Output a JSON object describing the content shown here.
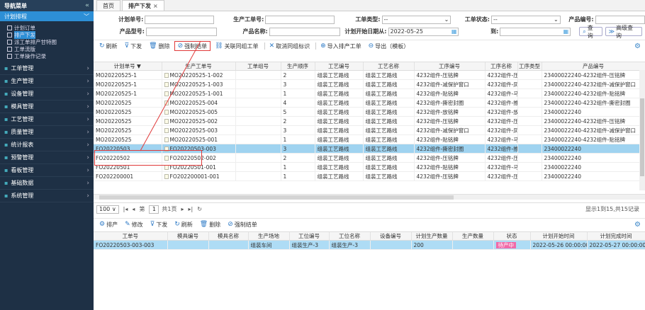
{
  "sidebar": {
    "title": "导航菜单",
    "collapse": "«",
    "plan": "计划排程",
    "plan_arrow": "﹀",
    "sub_items": [
      "计划订单",
      "排产下发",
      "派工单排产甘特图",
      "工单流版",
      "工单操作记录"
    ],
    "groups": [
      "工单管理",
      "生产管理",
      "设备管理",
      "模具管理",
      "工艺管理",
      "质量管理",
      "统计报表",
      "预警管理",
      "看板管理",
      "基础数据",
      "系统管理"
    ]
  },
  "tabs": [
    {
      "label": "首页"
    },
    {
      "label": "排产下发",
      "close": "×"
    }
  ],
  "filters": {
    "plan_no": "计划单号:",
    "work_no": "生产工单号:",
    "work_type": "工单类型:",
    "work_type_value": "--",
    "work_status": "工单状态:",
    "work_status_value": "--",
    "product_code": "产品编号:",
    "product_model": "产品型号:",
    "product_name": "产品名称:",
    "start_date": "计划开始日期从:",
    "start_date_value": "2022-05-25",
    "to": "到:",
    "query": "查询",
    "advanced": "高级查询"
  },
  "toolbar": [
    "刷新",
    "下发",
    "删除",
    "强制结单",
    "关联同组工单",
    "取消同组标识",
    "导入排产工单",
    "导出（模板）"
  ],
  "grid1": {
    "headers": [
      "计划单号 ▼",
      "生产工单号",
      "工单组号",
      "生产顺序",
      "工艺编号",
      "工艺名称",
      "工序编号",
      "工序名称",
      "工序类型",
      "产品编号"
    ],
    "rows": [
      [
        "MO20220525-1",
        "MO20220525-1-002",
        "",
        "2",
        "组装工艺路线",
        "组装工艺路线",
        "4232组件-压铭牌",
        "4232组件-压 组装",
        "23400022240-4232组件-压铭牌"
      ],
      [
        "MO20220525-1",
        "MO20220525-1-003",
        "",
        "3",
        "组装工艺路线",
        "组装工艺路线",
        "4232组件-减保护窗口",
        "4232组件-凤 组装",
        "23400022240-4232组件-减保护窗口"
      ],
      [
        "MO20220525-1",
        "MO20220525-1-001",
        "",
        "1",
        "组装工艺路线",
        "组装工艺路线",
        "4232组件-贴铭牌",
        "4232组件-马 组装",
        "23400022240-4232组件-贴铭牌"
      ],
      [
        "MO20220525",
        "MO20220525-004",
        "",
        "4",
        "组装工艺路线",
        "组装工艺路线",
        "4232组件-撕密封圈",
        "4232组件-推 组装",
        "23400022240-4232组件-撕密封圈"
      ],
      [
        "MO20220525",
        "MO20220525-005",
        "",
        "5",
        "组装工艺路线",
        "组装工艺路线",
        "4232组件-放铭牌",
        "4232组件-放 组装",
        "23400022240"
      ],
      [
        "MO20220525",
        "MO20220525-002",
        "",
        "2",
        "组装工艺路线",
        "组装工艺路线",
        "4232组件-压铭牌",
        "4232组件-压 组装",
        "23400022240-4232组件-压铭牌"
      ],
      [
        "MO20220525",
        "MO20220525-003",
        "",
        "3",
        "组装工艺路线",
        "组装工艺路线",
        "4232组件-减保护窗口",
        "4232组件-凤 组装",
        "23400022240-4232组件-减保护窗口"
      ],
      [
        "MO20220525",
        "MO20220525-001",
        "",
        "1",
        "组装工艺路线",
        "组装工艺路线",
        "4232组件-贴铭牌",
        "4232组件-马 组装",
        "23400022240-4232组件-贴铭牌"
      ],
      [
        "FO20220503",
        "FO20220503-003",
        "",
        "3",
        "组装工艺路线",
        "组装工艺路线",
        "4232组件-撕密封圈",
        "4232组件-推 组装",
        "23400022240"
      ],
      [
        "FO20220502",
        "FO20220502-002",
        "",
        "2",
        "组装工艺路线",
        "组装工艺路线",
        "4232组件-压铭牌",
        "4232组件-压 组装",
        "23400022240"
      ],
      [
        "FO20220501",
        "FO20220501-001",
        "",
        "1",
        "组装工艺路线",
        "组装工艺路线",
        "4232组件-贴铭牌",
        "4232组件-马 组装",
        "23400022240"
      ],
      [
        "FO202200001",
        "FO202200001-001",
        "",
        "1",
        "组装工艺路线",
        "组装工艺路线",
        "4232组件-压铭牌",
        "4232组件-压 组装",
        "23400022240"
      ]
    ]
  },
  "pager": {
    "size": "100 ∨",
    "first": "|◂",
    "prev": "◂",
    "page_pre": "第",
    "page": "1",
    "page_post": "共1页",
    "next": "▸",
    "last": "▸|",
    "refresh": "↻",
    "info": "显示1到15,共15记录"
  },
  "toolbar2": [
    "排产",
    "修改",
    "下发",
    "刷新",
    "删除",
    "强制结单"
  ],
  "grid2": {
    "headers": [
      "工单号",
      "模具编号",
      "模具名称",
      "生产场地",
      "工位编号",
      "工位名称",
      "设备编号",
      "计划生产数量",
      "生产数量",
      "状态",
      "计划开始时间",
      "计划完成时间"
    ],
    "row": [
      "FO20220503-003-003",
      "",
      "",
      "组装车间",
      "组装生产-3",
      "组装生产-3",
      "",
      "200",
      "",
      "待产中",
      "2022-05-26 00:00:00",
      "2022-05-27 00:00:00"
    ]
  }
}
